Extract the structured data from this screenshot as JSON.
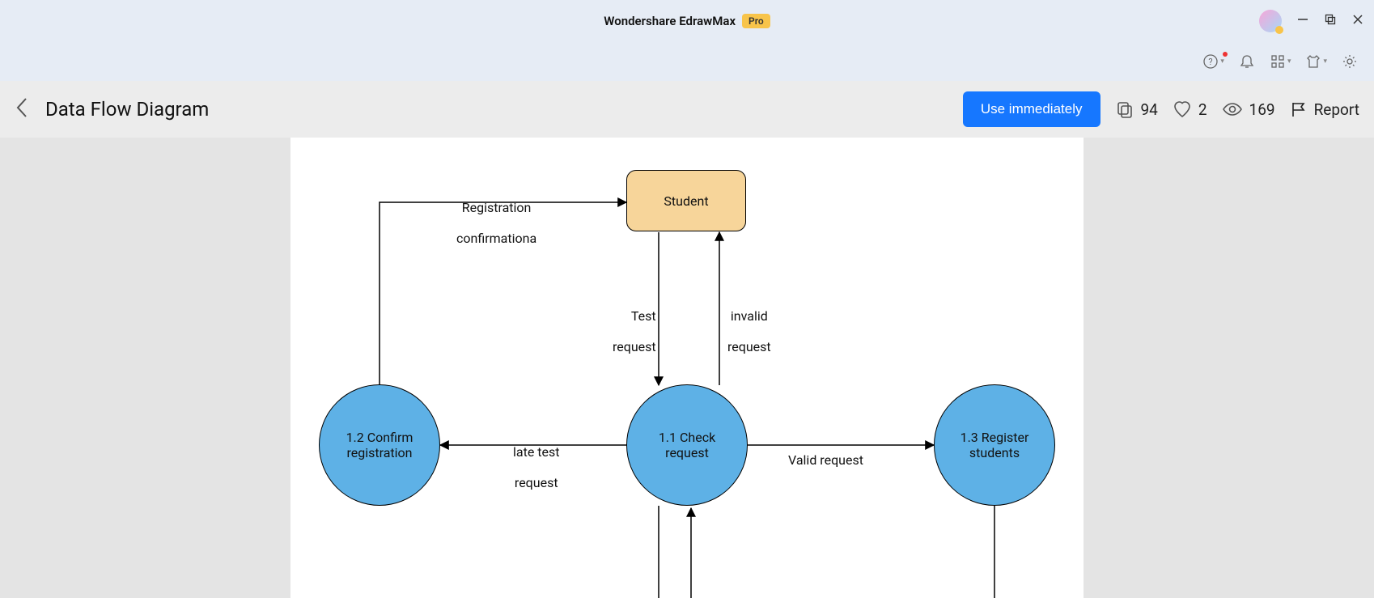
{
  "app": {
    "name": "Wondershare EdrawMax",
    "badge": "Pro"
  },
  "header": {
    "page_title": "Data Flow Diagram",
    "use_label": "Use immediately",
    "copies": "94",
    "likes": "2",
    "views": "169",
    "report_label": "Report"
  },
  "diagram": {
    "entity_student": "Student",
    "proc_confirm_line1": "1.2 Confirm",
    "proc_confirm_line2": "registration",
    "proc_check_line1": "1.1 Check",
    "proc_check_line2": "request",
    "proc_register_line1": "1.3 Register",
    "proc_register_line2": "students",
    "lbl_reg_conf_line1": "Registration",
    "lbl_reg_conf_line2": "confirmationa",
    "lbl_test_req_line1": "Test",
    "lbl_test_req_line2": "request",
    "lbl_invalid_line1": "invalid",
    "lbl_invalid_line2": "request",
    "lbl_late_line1": "late test",
    "lbl_late_line2": "request",
    "lbl_valid": "Valid request"
  }
}
